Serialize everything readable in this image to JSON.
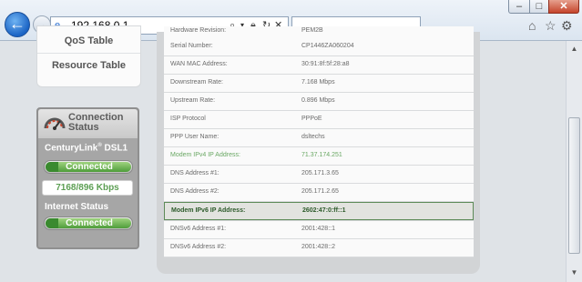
{
  "browser": {
    "url": "192.168.0.1",
    "window_buttons": {
      "minimize": "–",
      "maximize": "□",
      "close": "✕"
    },
    "address_icons": [
      "search-icon",
      "lock-icon",
      "refresh-icon",
      "stop-icon"
    ],
    "toolbar_icons": [
      "home-icon",
      "favorites-star-icon",
      "gear-icon"
    ]
  },
  "sidebar": {
    "items": [
      {
        "label": "QoS Table"
      },
      {
        "label": "Resource Table"
      }
    ]
  },
  "connection_status": {
    "title_line1": "Connection",
    "title_line2": "Status",
    "provider": "CenturyLink",
    "provider_sup": "®",
    "link_type": "DSL1",
    "dsl_status": "Connected",
    "rate": "7168/896 Kbps",
    "internet_label": "Internet Status",
    "internet_status": "Connected"
  },
  "details": {
    "rows": [
      {
        "label": "Hardware Revision:",
        "value": "PEM2B"
      },
      {
        "label": "Serial Number:",
        "value": "CP1446ZA060204"
      },
      {
        "label": "WAN MAC Address:",
        "value": "30:91:8f:5f:28:a8"
      },
      {
        "label": "Downstream Rate:",
        "value": "7.168 Mbps"
      },
      {
        "label": "Upstream Rate:",
        "value": "0.896 Mbps"
      },
      {
        "label": "ISP Protocol",
        "value": "PPPoE"
      },
      {
        "label": "PPP User Name:",
        "value": "dsltechs"
      },
      {
        "label": "Modem IPv4 IP Address:",
        "value": "71.37.174.251"
      },
      {
        "label": "DNS Address #1:",
        "value": "205.171.3.65"
      },
      {
        "label": "DNS Address #2:",
        "value": "205.171.2.65"
      },
      {
        "label": "Modem IPv6 IP Address:",
        "value": "2602:47:0:ff::1"
      },
      {
        "label": "DNSv6 Address #1:",
        "value": "2001:428::1"
      },
      {
        "label": "DNSv6 Address #2:",
        "value": "2001:428::2"
      }
    ]
  },
  "colors": {
    "accent_green": "#6aa864",
    "highlight_border": "#5d8a57",
    "back_button_blue": "#1b64c5"
  }
}
